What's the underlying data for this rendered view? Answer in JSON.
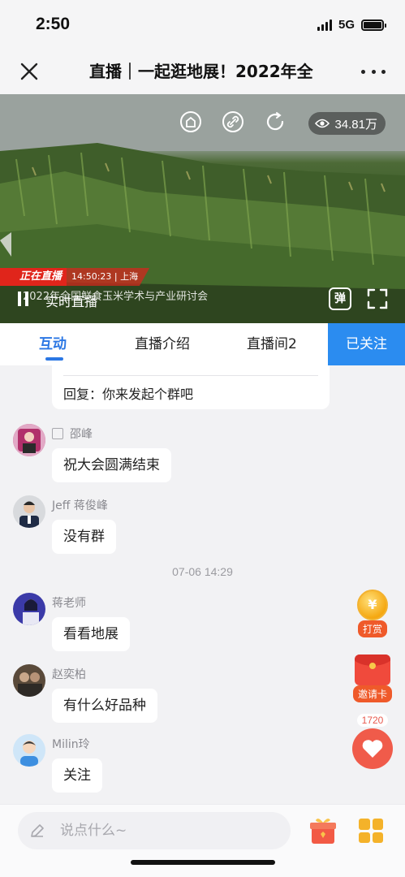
{
  "status_bar": {
    "time": "2:50",
    "network": "5G"
  },
  "nav": {
    "title": "直播｜一起逛地展！2022年全"
  },
  "video": {
    "viewers": "34.81万",
    "live_tag": "正在直播",
    "live_info": "14:50:23 | 上海",
    "subtitle": "2022年全国鲜食玉米学术与产业研讨会",
    "realtime_label": "实时直播",
    "danmu_label": "弹"
  },
  "tabs": [
    {
      "label": "互动"
    },
    {
      "label": "直播介绍"
    },
    {
      "label": "直播间2"
    }
  ],
  "follow_label": "已关注",
  "chat": {
    "reply_text": "回复：你来发起个群吧",
    "messages": [
      {
        "name": "邵峰",
        "text": "祝大会圆满结束"
      },
      {
        "name": "Jeff 蒋俊峰",
        "text": "没有群"
      },
      {
        "name": "蒋老师",
        "text": "看看地展"
      },
      {
        "name": "赵奕柏",
        "text": "有什么好品种"
      },
      {
        "name": "Milin玲",
        "text": "关注"
      }
    ],
    "time_divider": "07-06 14:29"
  },
  "floating": {
    "reward_symbol": "¥",
    "reward_label": "打赏",
    "invite_label": "邀请卡",
    "like_count": "1720"
  },
  "input": {
    "placeholder": "说点什么~"
  },
  "colors": {
    "accent": "#2b77e4",
    "follow_bg": "#2b8cf0",
    "live_red": "#e0251b"
  }
}
